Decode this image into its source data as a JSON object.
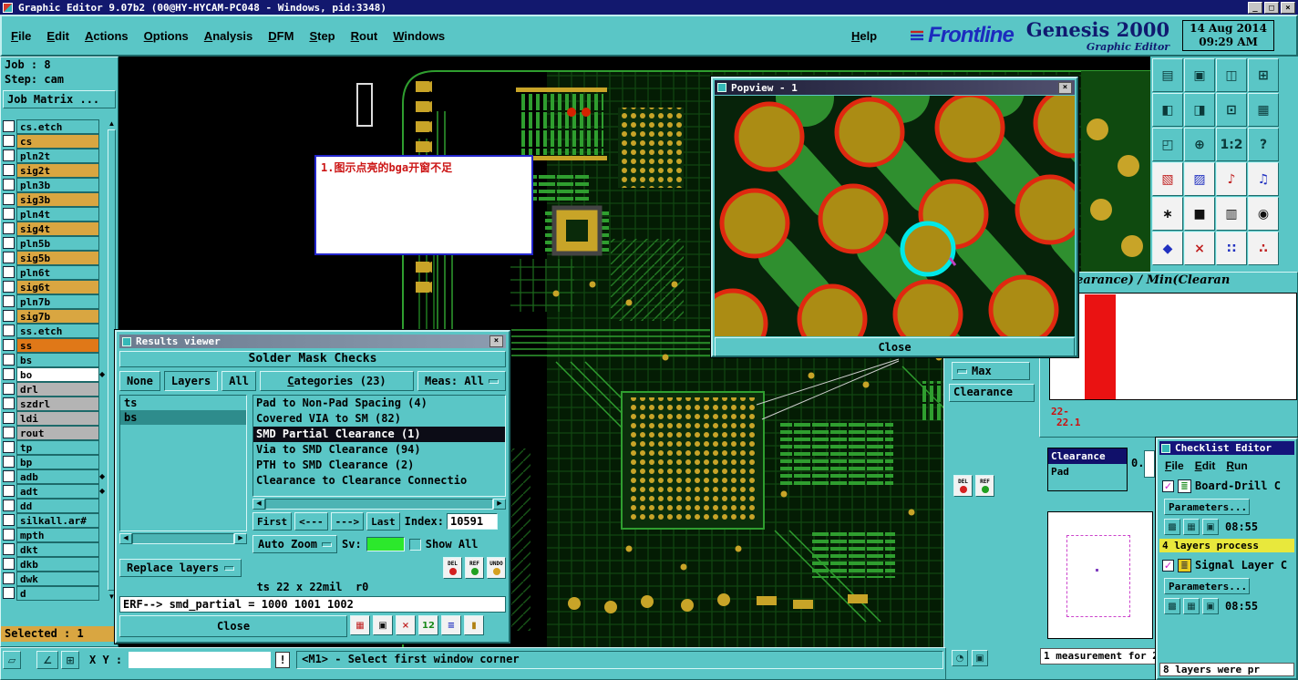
{
  "titlebar": {
    "title": "Graphic Editor 9.07b2 (00@HY-HYCAM-PC048 - Windows, pid:3348)",
    "minimize": "_",
    "maximize": "□",
    "close": "×"
  },
  "menubar": {
    "items": [
      "File",
      "Edit",
      "Actions",
      "Options",
      "Analysis",
      "DFM",
      "Step",
      "Rout",
      "Windows"
    ],
    "help": "Help"
  },
  "brand": {
    "logo": "Frontline",
    "product": "Genesis 2000",
    "edition": "Graphic Editor",
    "date": "14 Aug 2014",
    "time": "09:29 AM"
  },
  "sidebar": {
    "job": "Job : 8",
    "step": "Step: cam",
    "matrix": "Job Matrix ...",
    "selected": "Selected : 1",
    "layers": [
      {
        "name": "cs.etch",
        "type": "teal"
      },
      {
        "name": "cs",
        "type": "gold"
      },
      {
        "name": "pln2t",
        "type": "teal"
      },
      {
        "name": "sig2t",
        "type": "gold"
      },
      {
        "name": "pln3b",
        "type": "teal"
      },
      {
        "name": "sig3b",
        "type": "gold"
      },
      {
        "name": "pln4t",
        "type": "teal"
      },
      {
        "name": "sig4t",
        "type": "gold"
      },
      {
        "name": "pln5b",
        "type": "teal"
      },
      {
        "name": "sig5b",
        "type": "gold"
      },
      {
        "name": "pln6t",
        "type": "teal"
      },
      {
        "name": "sig6t",
        "type": "gold"
      },
      {
        "name": "pln7b",
        "type": "teal"
      },
      {
        "name": "sig7b",
        "type": "gold"
      },
      {
        "name": "ss.etch",
        "type": "teal"
      },
      {
        "name": "ss",
        "type": "orange"
      },
      {
        "name": "bs",
        "type": "teal"
      },
      {
        "name": "bo",
        "type": "white",
        "marker": "◆"
      },
      {
        "name": "drl",
        "type": "gray"
      },
      {
        "name": "szdrl",
        "type": "gray"
      },
      {
        "name": "ldi",
        "type": "gray"
      },
      {
        "name": "rout",
        "type": "gray"
      },
      {
        "name": "tp",
        "type": "teal"
      },
      {
        "name": "bp",
        "type": "teal"
      },
      {
        "name": "adb",
        "type": "teal",
        "marker": "◆"
      },
      {
        "name": "adt",
        "type": "teal",
        "marker": "◆"
      },
      {
        "name": "dd",
        "type": "teal"
      },
      {
        "name": "silkall.ar#",
        "type": "teal"
      },
      {
        "name": "mpth",
        "type": "teal"
      },
      {
        "name": "dkt",
        "type": "teal"
      },
      {
        "name": "dkb",
        "type": "teal"
      },
      {
        "name": "dwk",
        "type": "teal"
      },
      {
        "name": "d",
        "type": "teal"
      }
    ]
  },
  "canvas": {
    "annotation": "1.图示点亮的bga开窗不足"
  },
  "popview": {
    "title": "Popview - 1",
    "close": "Close"
  },
  "results": {
    "title": "Results viewer",
    "header": "Solder Mask Checks",
    "filters": {
      "none": "None",
      "layers": "Layers",
      "all": "All"
    },
    "categories": "Categories (23)",
    "meas": "Meas: All",
    "layer_list": [
      {
        "name": "ts"
      },
      {
        "name": "bs",
        "selected": true
      }
    ],
    "items": [
      {
        "label": "Pad to Non-Pad Spacing (4)"
      },
      {
        "label": "Covered VIA to SM (82)"
      },
      {
        "label": "SMD Partial Clearance (1)",
        "selected": true
      },
      {
        "label": "Via to SMD Clearance (94)"
      },
      {
        "label": "PTH to SMD Clearance (2)"
      },
      {
        "label": "Clearance to Clearance Connectio"
      }
    ],
    "nav": {
      "first": "First",
      "prev": "<---",
      "next": "--->",
      "last": "Last",
      "index_label": "Index:",
      "index": "10591"
    },
    "auto_zoom": "Auto Zoom",
    "sv": "Sv:",
    "show_all": "Show All",
    "replace": "Replace layers",
    "tools": [
      {
        "label": "DEL",
        "v": "r"
      },
      {
        "label": "REF",
        "v": "g"
      },
      {
        "label": "UNDO",
        "v": "y"
      }
    ],
    "info": "ts 22 x 22mil  r0",
    "erf": "ERF--> smd_partial = 1000 1001 1002",
    "close": "Close",
    "bottom_tools": [
      {
        "g": "▦",
        "v": "r"
      },
      {
        "g": "▣",
        "v": "d"
      },
      {
        "g": "×",
        "v": "r"
      },
      {
        "g": "12",
        "v": "g"
      },
      {
        "g": "≡",
        "v": "b"
      },
      {
        "g": "▮",
        "v": "y"
      }
    ]
  },
  "histogram": {
    "header": "ze(Clearance) / Min(Clearan",
    "tick_top": "22-",
    "tick_bottom": "22.1"
  },
  "clearance": {
    "max": "Max",
    "label": "Clearance",
    "box_selected": "Clearance",
    "box_second": "Pad",
    "value": "0.",
    "tools": [
      {
        "label": "DEL",
        "v": "r"
      },
      {
        "label": "REF",
        "v": "g"
      }
    ]
  },
  "measure": {
    "status": "1 measurement for 2"
  },
  "checklist": {
    "title": "Checklist Editor",
    "menus": [
      "File",
      "Edit",
      "Run"
    ],
    "item1": "Board-Drill C",
    "params": "Parameters...",
    "time1": "08:55",
    "note": "4 layers process",
    "item2": "Signal Layer C",
    "time2": "08:55",
    "footer": "8 layers were pr",
    "tools": [
      {
        "g": "▩"
      },
      {
        "g": "▦"
      },
      {
        "g": "▣"
      }
    ]
  },
  "statusbar": {
    "xy": "X Y :",
    "value": "",
    "alert": "!",
    "message": "<M1> - Select first window corner",
    "tools": [
      {
        "g": "▱"
      },
      {
        "g": "∠"
      },
      {
        "g": "⊞"
      }
    ]
  },
  "toolbar": {
    "buttons": [
      {
        "g": "▤"
      },
      {
        "g": "▣"
      },
      {
        "g": "◫"
      },
      {
        "g": "⊞"
      },
      {
        "g": "◧"
      },
      {
        "g": "◨"
      },
      {
        "g": "⊡"
      },
      {
        "g": "▦"
      },
      {
        "g": "◰"
      },
      {
        "g": "⊕"
      },
      {
        "g": "1:2"
      },
      {
        "g": "?"
      },
      {
        "g": "▧",
        "v": "r"
      },
      {
        "g": "▨",
        "v": "b"
      },
      {
        "g": "♪",
        "v": "r"
      },
      {
        "g": "♫",
        "v": "b"
      },
      {
        "g": "∗",
        "v": "w"
      },
      {
        "g": "■",
        "v": "w"
      },
      {
        "g": "▥",
        "v": "w"
      },
      {
        "g": "◉",
        "v": "w"
      },
      {
        "g": "◆",
        "v": "b"
      },
      {
        "g": "×",
        "v": "r"
      },
      {
        "g": "∷",
        "v": "b"
      },
      {
        "g": "∴",
        "v": "r"
      }
    ]
  }
}
